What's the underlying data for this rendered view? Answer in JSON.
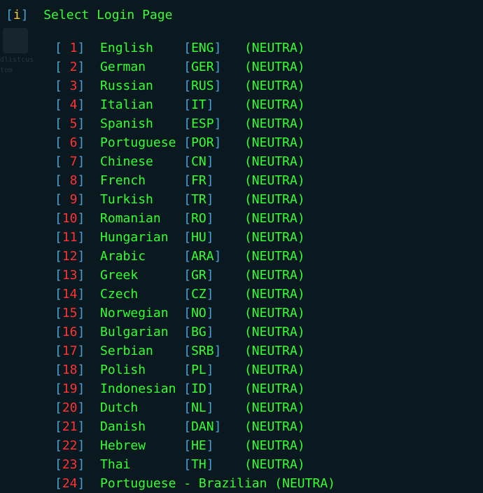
{
  "prompt": {
    "info_char": "i",
    "title": "Select Login Page"
  },
  "special_last": {
    "id": "24",
    "full_label": "Portuguese - Brazilian (NEUTRA)"
  },
  "items": [
    {
      "id": "1",
      "name": "English",
      "code": "ENG",
      "desc": "NEUTRA"
    },
    {
      "id": "2",
      "name": "German",
      "code": "GER",
      "desc": "NEUTRA"
    },
    {
      "id": "3",
      "name": "Russian",
      "code": "RUS",
      "desc": "NEUTRA"
    },
    {
      "id": "4",
      "name": "Italian",
      "code": "IT",
      "desc": "NEUTRA"
    },
    {
      "id": "5",
      "name": "Spanish",
      "code": "ESP",
      "desc": "NEUTRA"
    },
    {
      "id": "6",
      "name": "Portuguese",
      "code": "POR",
      "desc": "NEUTRA"
    },
    {
      "id": "7",
      "name": "Chinese",
      "code": "CN",
      "desc": "NEUTRA"
    },
    {
      "id": "8",
      "name": "French",
      "code": "FR",
      "desc": "NEUTRA"
    },
    {
      "id": "9",
      "name": "Turkish",
      "code": "TR",
      "desc": "NEUTRA"
    },
    {
      "id": "10",
      "name": "Romanian",
      "code": "RO",
      "desc": "NEUTRA"
    },
    {
      "id": "11",
      "name": "Hungarian",
      "code": "HU",
      "desc": "NEUTRA"
    },
    {
      "id": "12",
      "name": "Arabic",
      "code": "ARA",
      "desc": "NEUTRA"
    },
    {
      "id": "13",
      "name": "Greek",
      "code": "GR",
      "desc": "NEUTRA"
    },
    {
      "id": "14",
      "name": "Czech",
      "code": "CZ",
      "desc": "NEUTRA"
    },
    {
      "id": "15",
      "name": "Norwegian",
      "code": "NO",
      "desc": "NEUTRA"
    },
    {
      "id": "16",
      "name": "Bulgarian",
      "code": "BG",
      "desc": "NEUTRA"
    },
    {
      "id": "17",
      "name": "Serbian",
      "code": "SRB",
      "desc": "NEUTRA"
    },
    {
      "id": "18",
      "name": "Polish",
      "code": "PL",
      "desc": "NEUTRA"
    },
    {
      "id": "19",
      "name": "Indonesian",
      "code": "ID",
      "desc": "NEUTRA"
    },
    {
      "id": "20",
      "name": "Dutch",
      "code": "NL",
      "desc": "NEUTRA"
    },
    {
      "id": "21",
      "name": "Danish",
      "code": "DAN",
      "desc": "NEUTRA"
    },
    {
      "id": "22",
      "name": "Hebrew",
      "code": "HE",
      "desc": "NEUTRA"
    },
    {
      "id": "23",
      "name": "Thai",
      "code": "TH",
      "desc": "NEUTRA"
    }
  ]
}
